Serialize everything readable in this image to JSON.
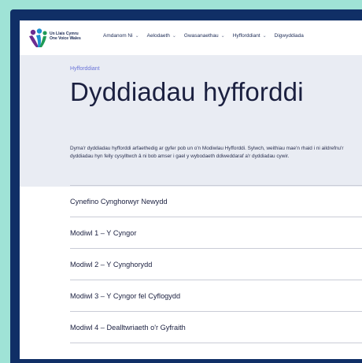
{
  "header": {
    "org_line1": "Un Llais Cymru",
    "org_line2": "One Voice Wales",
    "nav": [
      {
        "label": "Amdanom Ni"
      },
      {
        "label": "Aelodaeth"
      },
      {
        "label": "Gwasanaethau"
      },
      {
        "label": "Hyfforddiant"
      },
      {
        "label": "Digwyddiada"
      }
    ]
  },
  "page": {
    "breadcrumb": "Hyfforddiant",
    "title": "Dyddiadau hyfforddi",
    "intro": "Dyma'r dyddiadau hyfforddi arfaethedig ar gyfer pob un o'n Modiwlau Hyfforddi. Sylwch, weithiau mae'n rhaid i ni aildrefnu'r dyddiadau hyn felly cysylltwch â ni bob amser i gael y wybodaeth ddiweddaraf a'r dyddiadau cywir."
  },
  "modules": [
    {
      "label": "Cynefino Cynghorwyr Newydd"
    },
    {
      "label": "Modiwl 1 – Y Cyngor"
    },
    {
      "label": "Modiwl 2 – Y Cynghorydd"
    },
    {
      "label": "Modiwl 3 – Y Cyngor fel Cyflogydd"
    },
    {
      "label": "Modiwl 4 – Dealltwriaeth o'r Gyfraith"
    }
  ],
  "colors": {
    "background": "#9fe3d6",
    "frame": "#102f66",
    "hero": "#e9ecf3",
    "breadcrumb": "#6a74d8"
  }
}
